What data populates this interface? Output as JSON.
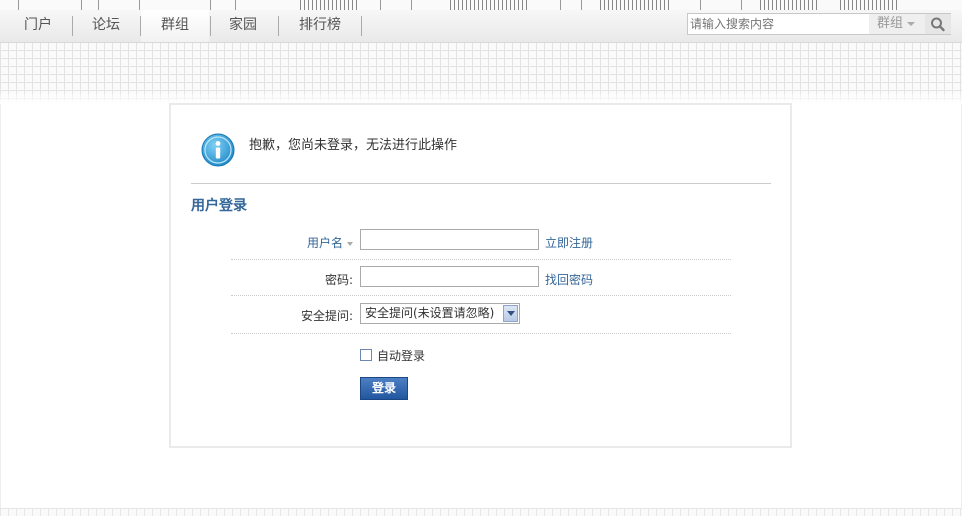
{
  "nav": {
    "items": [
      {
        "label": "门户"
      },
      {
        "label": "论坛"
      },
      {
        "label": "群组"
      },
      {
        "label": "家园"
      },
      {
        "label": "排行榜"
      }
    ],
    "active_label": "群组"
  },
  "search": {
    "placeholder": "请输入搜索内容",
    "type_label": "群组"
  },
  "notice": {
    "text": "抱歉，您尚未登录，无法进行此操作"
  },
  "login": {
    "section_title": "用户登录",
    "username_label": "用户名",
    "register_link": "立即注册",
    "password_label": "密码:",
    "recover_link": "找回密码",
    "question_label": "安全提问:",
    "question_selected": "安全提问(未设置请忽略)",
    "auto_login_label": "自动登录",
    "submit_label": "登录"
  },
  "colors": {
    "link": "#336699",
    "button": "#22579f"
  }
}
